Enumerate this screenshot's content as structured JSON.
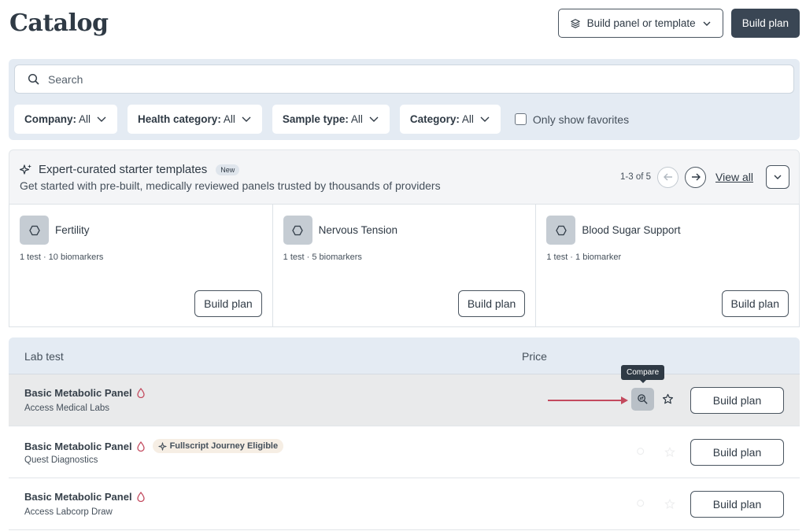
{
  "page": {
    "title": "Catalog"
  },
  "header": {
    "build_panel_label": "Build panel or template",
    "build_plan_label": "Build plan"
  },
  "search": {
    "placeholder": "Search"
  },
  "filters": [
    {
      "key": "Company:",
      "value": "All"
    },
    {
      "key": "Health category:",
      "value": "All"
    },
    {
      "key": "Sample type:",
      "value": "All"
    },
    {
      "key": "Category:",
      "value": "All"
    }
  ],
  "favorites_label": "Only show favorites",
  "templates": {
    "title": "Expert-curated starter templates",
    "badge": "New",
    "subtitle": "Get started with pre-built, medically reviewed panels trusted by thousands of providers",
    "pager": "1-3 of 5",
    "view_all": "View all",
    "cards": [
      {
        "name": "Fertility",
        "meta": "1 test · 10 biomarkers",
        "button": "Build plan"
      },
      {
        "name": "Nervous Tension",
        "meta": "1 test · 5 biomarkers",
        "button": "Build plan"
      },
      {
        "name": "Blood Sugar Support",
        "meta": "1 test · 1 biomarker",
        "button": "Build plan"
      }
    ]
  },
  "table": {
    "columns": [
      "Lab test",
      "Price"
    ],
    "rows": [
      {
        "name": "Basic Metabolic Panel",
        "lab": "Access Medical Labs",
        "badge": "",
        "button": "Build plan"
      },
      {
        "name": "Basic Metabolic Panel",
        "lab": "Quest Diagnostics",
        "badge": "Fullscript Journey Eligible",
        "button": "Build plan"
      },
      {
        "name": "Basic Metabolic Panel",
        "lab": "Access Labcorp Draw",
        "badge": "",
        "button": "Build plan"
      }
    ],
    "tooltip": "Compare"
  },
  "colors": {
    "accent_dark": "#3a4654",
    "panel_bg": "#e4ebf3",
    "drop_red": "#c34a5e",
    "journey_bg": "#f6eee4"
  }
}
